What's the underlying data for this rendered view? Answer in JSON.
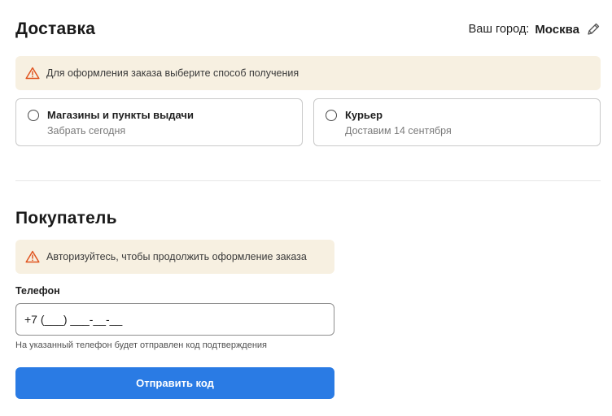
{
  "delivery": {
    "title": "Доставка",
    "city_label": "Ваш город:",
    "city_name": "Москва",
    "alert_text": "Для оформления заказа выберите способ получения",
    "options": [
      {
        "title": "Магазины и пункты выдачи",
        "subtitle": "Забрать сегодня",
        "selected": false
      },
      {
        "title": "Курьер",
        "subtitle": "Доставим 14 сентября",
        "selected": false
      }
    ]
  },
  "buyer": {
    "title": "Покупатель",
    "alert_text": "Авторизуйтесь, чтобы продолжить оформление заказа",
    "phone_label": "Телефон",
    "phone_placeholder": "+7 (___) ___-__-__",
    "phone_hint": "На указанный телефон будет отправлен код подтверждения",
    "submit_label": "Отправить код"
  },
  "colors": {
    "alert_bg": "#f7f0e1",
    "warning_icon": "#e0541f",
    "primary_button": "#2a7be4"
  },
  "icons": {
    "city_edit": "pencil-icon",
    "alert": "warning-icon",
    "option_radio": "radio-icon"
  }
}
